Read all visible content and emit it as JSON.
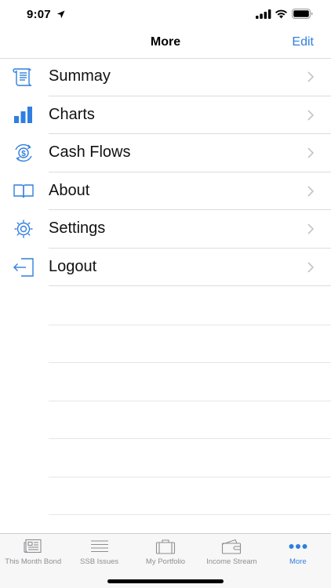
{
  "status_bar": {
    "time": "9:07",
    "icons": [
      "location-arrow-icon",
      "cellular-signal-icon",
      "wifi-icon",
      "battery-icon"
    ]
  },
  "nav": {
    "title": "More",
    "edit_label": "Edit"
  },
  "accent_color": "#2f7fde",
  "menu": {
    "items": [
      {
        "label": "Summay",
        "icon": "scroll-icon"
      },
      {
        "label": "Charts",
        "icon": "bar-chart-icon"
      },
      {
        "label": "Cash Flows",
        "icon": "cash-flow-icon"
      },
      {
        "label": "About",
        "icon": "open-book-icon"
      },
      {
        "label": "Settings",
        "icon": "gear-icon"
      },
      {
        "label": "Logout",
        "icon": "logout-icon"
      }
    ]
  },
  "tab_bar": {
    "tabs": [
      {
        "label": "This Month Bond",
        "icon": "newspaper-icon",
        "active": false
      },
      {
        "label": "SSB Issues",
        "icon": "list-lines-icon",
        "active": false
      },
      {
        "label": "My Portfolio",
        "icon": "briefcase-icon",
        "active": false
      },
      {
        "label": "Income Stream",
        "icon": "wallet-icon",
        "active": false
      },
      {
        "label": "More",
        "icon": "more-dots-icon",
        "active": true
      }
    ]
  }
}
